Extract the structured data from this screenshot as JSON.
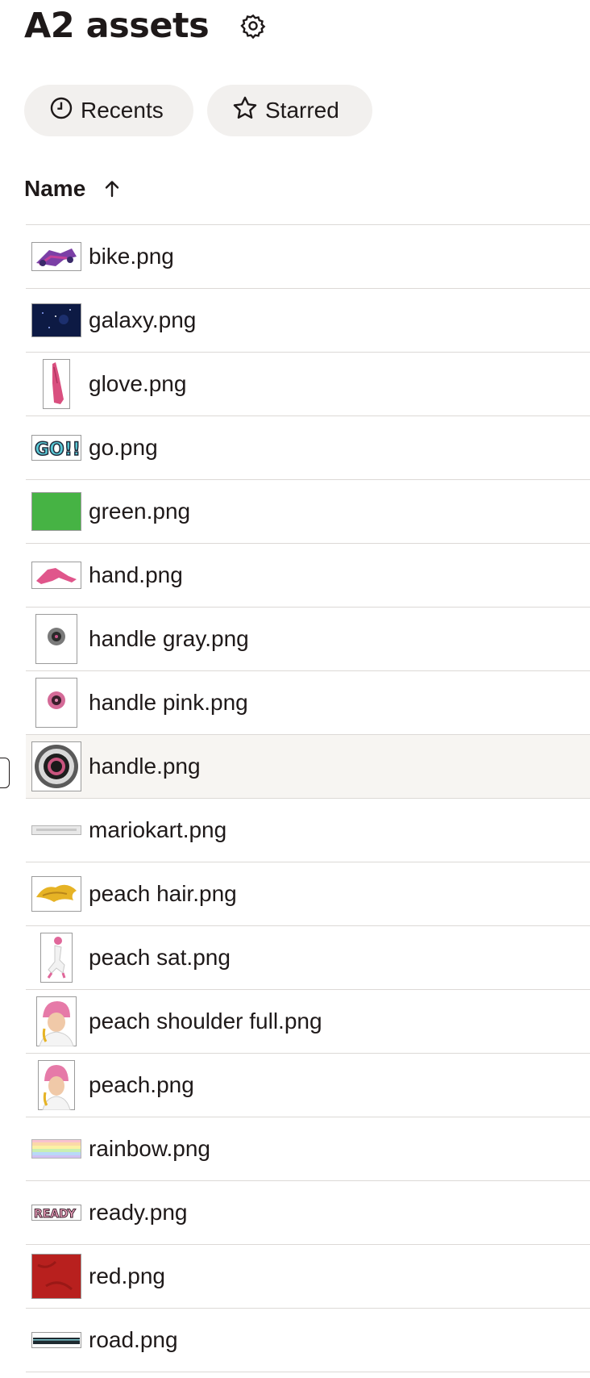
{
  "folder": {
    "title": "A2 assets"
  },
  "filters": {
    "recents": "Recents",
    "starred": "Starred"
  },
  "table": {
    "name_header": "Name",
    "sort": "ascending"
  },
  "files": [
    {
      "name": "bike.png",
      "thumb": "bike"
    },
    {
      "name": "galaxy.png",
      "thumb": "galaxy"
    },
    {
      "name": "glove.png",
      "thumb": "glove"
    },
    {
      "name": "go.png",
      "thumb": "go"
    },
    {
      "name": "green.png",
      "thumb": "green"
    },
    {
      "name": "hand.png",
      "thumb": "hand"
    },
    {
      "name": "handle gray.png",
      "thumb": "handle-gray"
    },
    {
      "name": "handle pink.png",
      "thumb": "handle-pink"
    },
    {
      "name": "handle.png",
      "thumb": "handle",
      "selected": true
    },
    {
      "name": "mariokart.png",
      "thumb": "mariokart"
    },
    {
      "name": "peach hair.png",
      "thumb": "peach-hair"
    },
    {
      "name": "peach sat.png",
      "thumb": "peach-sat"
    },
    {
      "name": "peach shoulder full.png",
      "thumb": "peach-shoulder"
    },
    {
      "name": "peach.png",
      "thumb": "peach"
    },
    {
      "name": "rainbow.png",
      "thumb": "rainbow"
    },
    {
      "name": "ready.png",
      "thumb": "ready"
    },
    {
      "name": "red.png",
      "thumb": "red"
    },
    {
      "name": "road.png",
      "thumb": "road"
    }
  ],
  "colors": {
    "text": "#1e1919",
    "chip_bg": "#f2f0ee",
    "divider": "#dcd9d6",
    "selected_row": "#f7f5f2"
  }
}
